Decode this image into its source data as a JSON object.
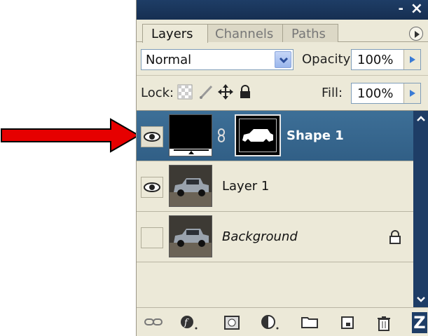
{
  "tabs": [
    "Layers",
    "Channels",
    "Paths"
  ],
  "blend": {
    "mode": "Normal",
    "opacity_label": "Opacity:",
    "opacity_value": "100%"
  },
  "lock": {
    "label": "Lock:",
    "fill_label": "Fill:",
    "fill_value": "100%"
  },
  "layers": [
    {
      "name": "Shape 1",
      "selected": true,
      "visible": true,
      "type": "shape"
    },
    {
      "name": "Layer 1",
      "selected": false,
      "visible": true,
      "type": "raster"
    },
    {
      "name": "Background",
      "selected": false,
      "visible": false,
      "type": "background",
      "locked": true
    }
  ],
  "titlebar": {
    "minimize": "-",
    "close": "×"
  },
  "bottom_badge": "Z",
  "colors": {
    "titlebar": "#1e3d66",
    "selected_layer": "#3d6f97",
    "panel_bg": "#ece9d8",
    "arrow": "#e60000"
  }
}
